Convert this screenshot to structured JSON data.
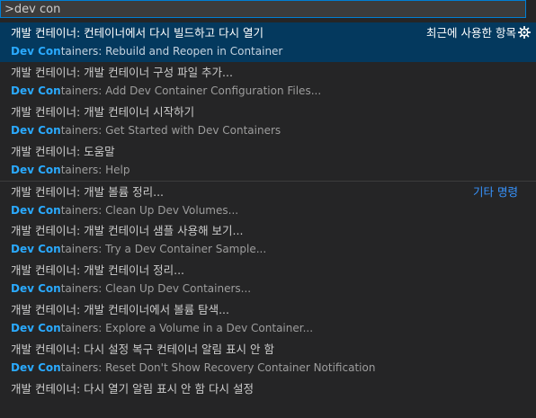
{
  "search": {
    "value": ">dev con"
  },
  "highlight": "Dev Con",
  "items": [
    {
      "ko": "개발 컨테이너: 컨테이너에서 다시 빌드하고 다시 열기",
      "en_rest": "tainers: Rebuild and Reopen in Container",
      "group": "최근에 사용한 항목",
      "selected": true
    },
    {
      "ko": "개발 컨테이너: 개발 컨테이너 구성 파일 추가...",
      "en_rest": "tainers: Add Dev Container Configuration Files..."
    },
    {
      "ko": "개발 컨테이너: 개발 컨테이너 시작하기",
      "en_rest": "tainers: Get Started with Dev Containers"
    },
    {
      "ko": "개발 컨테이너: 도움말",
      "en_rest": "tainers: Help"
    },
    {
      "ko": "개발 컨테이너: 개발 볼륨 정리...",
      "en_rest": "tainers: Clean Up Dev Volumes...",
      "group": "기타 명령",
      "separator": true
    },
    {
      "ko": "개발 컨테이너: 개발 컨테이너 샘플 사용해 보기...",
      "en_rest": "tainers: Try a Dev Container Sample..."
    },
    {
      "ko": "개발 컨테이너: 개발 컨테이너 정리...",
      "en_rest": "tainers: Clean Up Dev Containers..."
    },
    {
      "ko": "개발 컨테이너: 개발 컨테이너에서 볼륨 탐색...",
      "en_rest": "tainers: Explore a Volume in a Dev Container..."
    },
    {
      "ko": "개발 컨테이너: 다시 설정 복구 컨테이너 알림 표시 안 함",
      "en_rest": "tainers: Reset Don't Show Recovery Container Notification"
    },
    {
      "ko": "개발 컨테이너: 다시 열기 알림 표시 안 함 다시 설정",
      "en_rest": ""
    }
  ]
}
